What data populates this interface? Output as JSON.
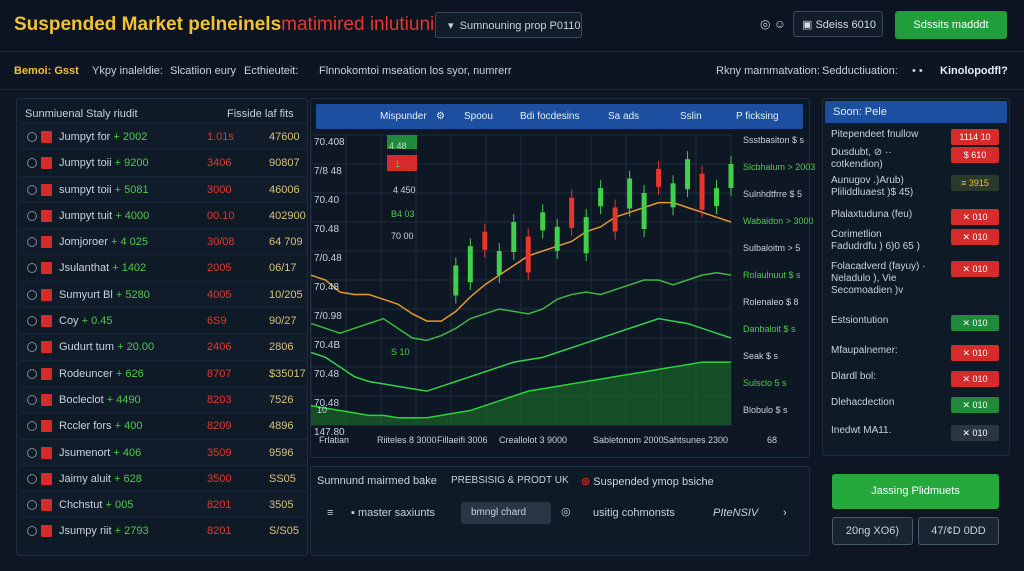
{
  "header": {
    "title_a": "Suspended Market pelneinels",
    "title_b": "matimired inlutiuning",
    "dropdown": "Sumnouning prop P0110",
    "icons": "◎  ☺",
    "badge": "Sdeiss 6010",
    "action_button": "Sdssits madddt"
  },
  "subnav": {
    "items": [
      "Bemoi: Gsst",
      "Ykpy inaleldie:",
      "Slcatiion eury",
      "Ecthieuteit:",
      "Flnnokomtoi mseation los syor, numrerr"
    ],
    "right_items": [
      "Rkny marnmatvation:",
      "Sedductiuation:",
      "• •",
      "Kinolopodfl?"
    ]
  },
  "left_panel": {
    "header_left": "Sunmiuenal Staly riudit",
    "header_right": "Fisside laf fits",
    "rows": [
      {
        "name": "Jumpyt for",
        "suffix": "+ 2002",
        "v1": "1.01s",
        "v2": "47600"
      },
      {
        "name": "Jumpyt toii",
        "suffix": "+ 9200",
        "v1": "3406",
        "v2": "90807"
      },
      {
        "name": "sumpyt toii",
        "suffix": "+ 5081",
        "v1": "3000",
        "v2": "46006"
      },
      {
        "name": "Jumpyt tuit",
        "suffix": "+ 4000",
        "v1": "00.10",
        "v2": "402900"
      },
      {
        "name": "Jomjoroer",
        "suffix": "+ 4 025",
        "v1": "30/08",
        "v2": "64 709"
      },
      {
        "name": "Jsulanthat",
        "suffix": "+ 1402",
        "v1": "2005",
        "v2": "06/17"
      },
      {
        "name": "Sumyurt Bl",
        "suffix": "+ 5280",
        "v1": "4005",
        "v2": "10/205"
      },
      {
        "name": "Coy",
        "suffix": "+ 0.45",
        "v1": "6S9",
        "v2": "90/27"
      },
      {
        "name": "Gudurt tum",
        "suffix": "+ 20.00",
        "v1": "2406",
        "v2": "2806"
      },
      {
        "name": "Rodeuncer",
        "suffix": "+ 626",
        "v1": "8707",
        "v2": "$35017"
      },
      {
        "name": "Bocleclot",
        "suffix": "+ 4490",
        "v1": "8203",
        "v2": "7526"
      },
      {
        "name": "Rccler fors",
        "suffix": "+ 400",
        "v1": "8209",
        "v2": "4896"
      },
      {
        "name": "Jsumenort",
        "suffix": "+ 406",
        "v1": "3509",
        "v2": "9596"
      },
      {
        "name": "Jaimy aluit",
        "suffix": "+ 628",
        "v1": "3500",
        "v2": "SS05"
      },
      {
        "name": "Chchstut",
        "suffix": "+ 005",
        "v1": "8201",
        "v2": "3505"
      },
      {
        "name": "Jsumpy riit",
        "suffix": "+ 2793",
        "v1": "8201",
        "v2": "S/S05"
      }
    ]
  },
  "chart_panel": {
    "tabs": [
      "Mispunder",
      "Spoou",
      "Bdi focdesins",
      "Sa ads",
      "Sslin",
      "P ficksing"
    ],
    "y_labels": [
      "70.408",
      "7/8 48",
      "70.40",
      "70.48",
      "7/0.48",
      "70.48",
      "7/0.98",
      "70.4B",
      "70.48",
      "70.48",
      "147.80"
    ],
    "right_labels": [
      "Ssstbasiton $ s",
      "Slcbhalum > 2003",
      "Sulnhdtfrre $ 5",
      "Wabaidon > 3000",
      "Sulbaloitm > 5",
      "Rolaulnuut $ s",
      "Rolenaleo $ 8",
      "Danbaloit $ s",
      "Seak $ s",
      "Sulsclo 5 s",
      "Blobulo $ s"
    ],
    "x_labels": [
      "Frlatian",
      "Riiteles 8 3000",
      "Fillaeifi 3006",
      "Creallolot 3 9000",
      "Sabletonom 2000",
      "Sahtsunes 2300",
      "68"
    ],
    "overlay_labels": [
      "4 48",
      "1",
      "4 450",
      "B4 03",
      "70 00",
      "S 10",
      "10"
    ]
  },
  "chart_data": {
    "type": "line",
    "x": [
      0,
      1,
      2,
      3,
      4,
      5,
      6,
      7,
      8,
      9,
      10,
      11,
      12,
      13,
      14,
      15,
      16,
      17,
      18,
      19,
      20,
      21,
      22,
      23,
      24,
      25,
      26,
      27,
      28,
      29
    ],
    "series": [
      {
        "values": [
          62,
          60,
          55,
          54,
          54,
          52,
          50,
          46,
          43,
          43,
          47,
          53,
          58,
          62,
          66,
          70,
          72,
          74,
          76,
          80,
          82,
          86,
          88,
          90,
          92,
          92,
          90,
          88,
          86,
          84
        ]
      },
      {
        "values": [
          42,
          40,
          38,
          40,
          42,
          44,
          40,
          36,
          35,
          37,
          40,
          44,
          46,
          48,
          47,
          46,
          48,
          52,
          54,
          55,
          54,
          56,
          58,
          60,
          60,
          58,
          60,
          62,
          63,
          62
        ]
      },
      {
        "values": [
          30,
          28,
          24,
          20,
          18,
          17,
          16,
          15,
          14,
          16,
          18,
          20,
          22,
          24,
          26,
          27,
          28,
          30,
          32,
          34,
          36,
          38,
          40,
          42,
          44,
          43,
          42,
          40,
          38,
          36
        ]
      },
      {
        "values": [
          8,
          7,
          6,
          5,
          4,
          4,
          3,
          3,
          3,
          4,
          5,
          6,
          8,
          10,
          12,
          14,
          15,
          16,
          17,
          18,
          19,
          20,
          21,
          22,
          23,
          24,
          25,
          26,
          26,
          26
        ]
      }
    ],
    "candles": [
      30,
      38,
      46,
      52,
      48,
      58,
      62,
      55,
      64,
      70,
      66,
      74,
      80,
      72,
      84,
      78,
      88,
      82,
      94,
      86,
      98,
      90,
      102,
      96,
      106,
      100,
      110,
      104,
      98,
      108
    ]
  },
  "bottom_panel": {
    "label_1": "Sumnund mairmed bake",
    "label_2": "PREBSISIG & PRODT UK",
    "label_3": "Suspended ymop bsiche",
    "label_4": "master saxiunts",
    "input_value": "bmngl chard",
    "label_5": "usitig cohmonsts",
    "label_6": "PIteNSIV"
  },
  "right_panel": {
    "header": "Soon: Pele",
    "rows": [
      {
        "label": "Pitependeet fnullow",
        "box": "1114 10",
        "style": "red"
      },
      {
        "label": "Dusdubt,  ⊘ ··\ncotkendion)",
        "box": "$ 610",
        "style": "red"
      },
      {
        "label": "Aunugov  .)Arub)\nPliliddluaest )$ 45)",
        "box": "≡ 3915",
        "style": "gold"
      },
      {
        "label": "Plalaxtuduna (feu)",
        "box": "✕ 010",
        "style": "red"
      },
      {
        "label": "Corimetlion\nFadudrdfu ) 6)0 65 )",
        "box": "✕ 010",
        "style": "red"
      },
      {
        "label": "Folacadverd (fayuy) ·\nNeladulo ), Vie\nSecomoadien )v",
        "box": "✕ 010",
        "style": "red"
      },
      {
        "label": "Estsiontution",
        "box": "✕ 010",
        "style": "green"
      },
      {
        "label": "Mfaupalnemer:",
        "box": "✕ 010",
        "style": "red"
      },
      {
        "label": "Dlardl bol:",
        "box": "✕ 010",
        "style": "red"
      },
      {
        "label": "Dlehacdection",
        "box": "✕ 010",
        "style": "green"
      },
      {
        "label": "Inedwt MA11.",
        "box": "✕ 010",
        "style": "dk"
      }
    ],
    "primary_button": "Jassing Plidmuets",
    "secondary_1": "20ng XO6)",
    "secondary_2": "47/¢D 0DD"
  }
}
